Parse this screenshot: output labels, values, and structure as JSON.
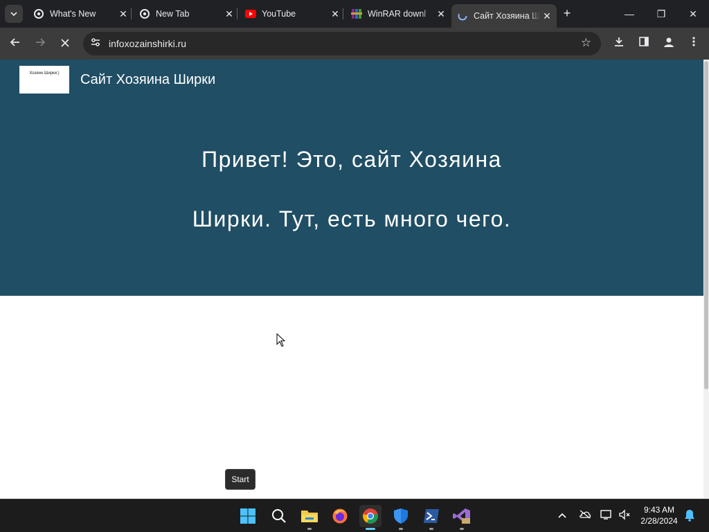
{
  "browser": {
    "tabs": [
      {
        "title": "What's New",
        "icon": "chrome-icon",
        "active": false
      },
      {
        "title": "New Tab",
        "icon": "chrome-icon",
        "active": false
      },
      {
        "title": "YouTube",
        "icon": "youtube-icon",
        "active": false
      },
      {
        "title": "WinRAR downl",
        "icon": "winrar-icon",
        "active": false
      },
      {
        "title": "Сайт Хозяина Ш",
        "icon": "loading-icon",
        "active": true
      }
    ],
    "address": "infoxozainshirki.ru"
  },
  "page": {
    "logo_text": "Хозяин Ширки:)",
    "site_title": "Сайт Хозяина Ширки",
    "hero_line1": "Привет! Это, сайт Хозяина",
    "hero_line2": "Ширки. Тут, есть много чего."
  },
  "tooltip": {
    "text": "Start"
  },
  "taskbar": {
    "apps": [
      "windows-start-icon",
      "search-icon",
      "file-explorer-icon",
      "firefox-icon",
      "chrome-icon",
      "windows-security-icon",
      "powershell-icon",
      "visual-studio-preview-icon"
    ],
    "time": "9:43 AM",
    "date": "2/28/2024"
  },
  "colors": {
    "hero_bg": "#204e64",
    "browser_frame": "#202124",
    "toolbar": "#3c3c3c"
  }
}
